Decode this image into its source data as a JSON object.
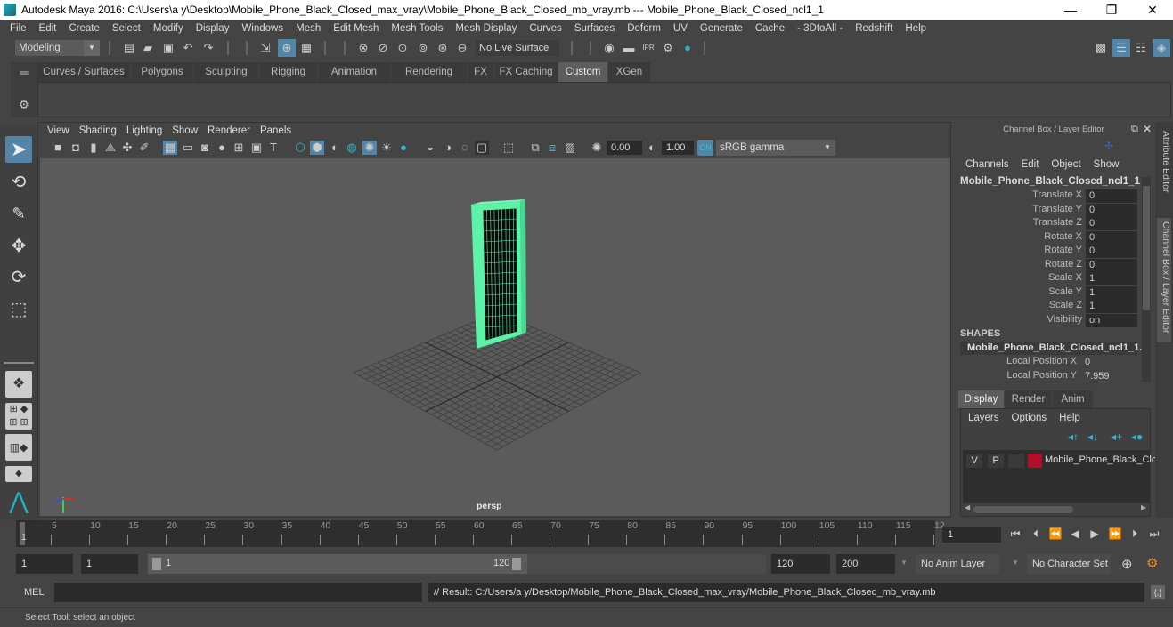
{
  "window": {
    "title": "Autodesk Maya 2016: C:\\Users\\a y\\Desktop\\Mobile_Phone_Black_Closed_max_vray\\Mobile_Phone_Black_Closed_mb_vray.mb  ---  Mobile_Phone_Black_Closed_ncl1_1",
    "minimize": "—",
    "maximize": "❐",
    "close": "✕"
  },
  "menubar": [
    "File",
    "Edit",
    "Create",
    "Select",
    "Modify",
    "Display",
    "Windows",
    "Mesh",
    "Edit Mesh",
    "Mesh Tools",
    "Mesh Display",
    "Curves",
    "Surfaces",
    "Deform",
    "UV",
    "Generate",
    "Cache",
    "- 3DtoAll -",
    "Redshift",
    "Help"
  ],
  "toolbar": {
    "mode": "Modeling",
    "live_surface": "No Live Surface",
    "icons": [
      "new-scene-icon",
      "open-scene-icon",
      "save-scene-icon",
      "undo-icon",
      "redo-icon",
      "select-hierarchy-icon",
      "select-object-icon",
      "select-component-icon",
      "snap-grid-icon",
      "snap-curve-icon",
      "snap-point-icon",
      "snap-projected-icon",
      "snap-view-icon",
      "make-live-icon",
      "render-view-icon",
      "render-current-icon",
      "ipr-render-icon",
      "render-settings-icon",
      "hypershade-icon",
      "modeling-toolkit-icon",
      "attribute-editor-toggle-icon",
      "tool-settings-toggle-icon",
      "channel-box-toggle-icon"
    ]
  },
  "shelf": {
    "tabs": [
      "Curves / Surfaces",
      "Polygons",
      "Sculpting",
      "Rigging",
      "Animation",
      "Rendering",
      "FX",
      "FX Caching",
      "Custom",
      "XGen"
    ],
    "active": "Custom"
  },
  "viewport": {
    "menu": [
      "View",
      "Shading",
      "Lighting",
      "Show",
      "Renderer",
      "Panels"
    ],
    "exposure": "0.00",
    "gamma": "1.00",
    "color_space": "sRGB gamma",
    "camera_label": "persp",
    "axis": {
      "x": "X",
      "y": "Y",
      "z": "Z"
    }
  },
  "channel_box": {
    "title": "Channel Box / Layer Editor",
    "menu": [
      "Channels",
      "Edit",
      "Object",
      "Show"
    ],
    "object_name": "Mobile_Phone_Black_Closed_ncl1_1",
    "channels": [
      {
        "label": "Translate X",
        "value": "0"
      },
      {
        "label": "Translate Y",
        "value": "0"
      },
      {
        "label": "Translate Z",
        "value": "0"
      },
      {
        "label": "Rotate X",
        "value": "0"
      },
      {
        "label": "Rotate Y",
        "value": "0"
      },
      {
        "label": "Rotate Z",
        "value": "0"
      },
      {
        "label": "Scale X",
        "value": "1"
      },
      {
        "label": "Scale Y",
        "value": "1"
      },
      {
        "label": "Scale Z",
        "value": "1"
      },
      {
        "label": "Visibility",
        "value": "on"
      }
    ],
    "shapes_header": "SHAPES",
    "shape_name": "Mobile_Phone_Black_Closed_ncl1_1...",
    "shape_channels": [
      {
        "label": "Local Position X",
        "value": "0"
      },
      {
        "label": "Local Position Y",
        "value": "7.959"
      }
    ]
  },
  "layer_editor": {
    "tabs": [
      "Display",
      "Render",
      "Anim"
    ],
    "active_tab": "Display",
    "menu": [
      "Layers",
      "Options",
      "Help"
    ],
    "layers": [
      {
        "v": "V",
        "p": "P",
        "color": "#b0102a",
        "name": "Mobile_Phone_Black_Clc"
      }
    ]
  },
  "side_tabs": [
    "Attribute Editor",
    "Channel Box / Layer Editor"
  ],
  "timeline": {
    "ticks": [
      5,
      10,
      15,
      20,
      25,
      30,
      35,
      40,
      45,
      50,
      55,
      60,
      65,
      70,
      75,
      80,
      85,
      90,
      95,
      100,
      105,
      110,
      115,
      "12"
    ],
    "current_marker": "1",
    "current_frame": "1"
  },
  "range": {
    "start": "1",
    "playback_start": "1",
    "slider_start": "1",
    "slider_end": "120",
    "playback_end": "120",
    "end": "200",
    "anim_layer": "No Anim Layer",
    "character_set": "No Character Set"
  },
  "command": {
    "lang": "MEL",
    "input": "",
    "result": "// Result: C:/Users/a y/Desktop/Mobile_Phone_Black_Closed_max_vray/Mobile_Phone_Black_Closed_mb_vray.mb"
  },
  "help_line": "Select Tool: select an object",
  "colors": {
    "accent": "#5285a6",
    "selection_wire": "#5cf2a8",
    "layer_color": "#b0102a"
  }
}
